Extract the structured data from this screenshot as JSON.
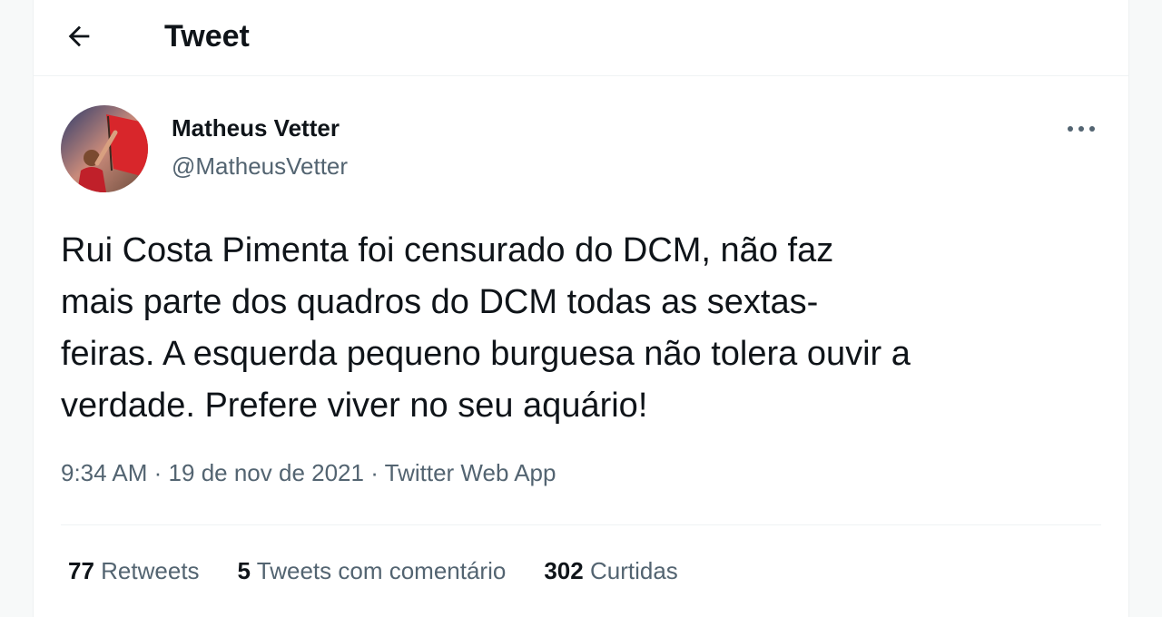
{
  "header": {
    "title": "Tweet",
    "back_icon": "arrow-left-icon"
  },
  "tweet": {
    "author": {
      "name": "Matheus Vetter",
      "handle": "@MatheusVetter",
      "avatar_icon": "profile-photo"
    },
    "more_icon": "more-horizontal-icon",
    "text": "Rui Costa Pimenta foi censurado do DCM, não faz\nmais parte dos quadros do DCM todas as sextas-\nfeiras. A esquerda pequeno burguesa não tolera ouvir a\nverdade. Prefere viver no seu aquário!",
    "time": "9:34 AM",
    "date": "19 de nov de 2021",
    "source": "Twitter Web App",
    "separator": "·"
  },
  "stats": {
    "retweets": {
      "count": "77",
      "label": "Retweets"
    },
    "quotes": {
      "count": "5",
      "label": "Tweets com comentário"
    },
    "likes": {
      "count": "302",
      "label": "Curtidas"
    }
  },
  "colors": {
    "text_primary": "#0f1419",
    "text_secondary": "#536471",
    "divider": "#eff3f4",
    "background": "#ffffff"
  }
}
